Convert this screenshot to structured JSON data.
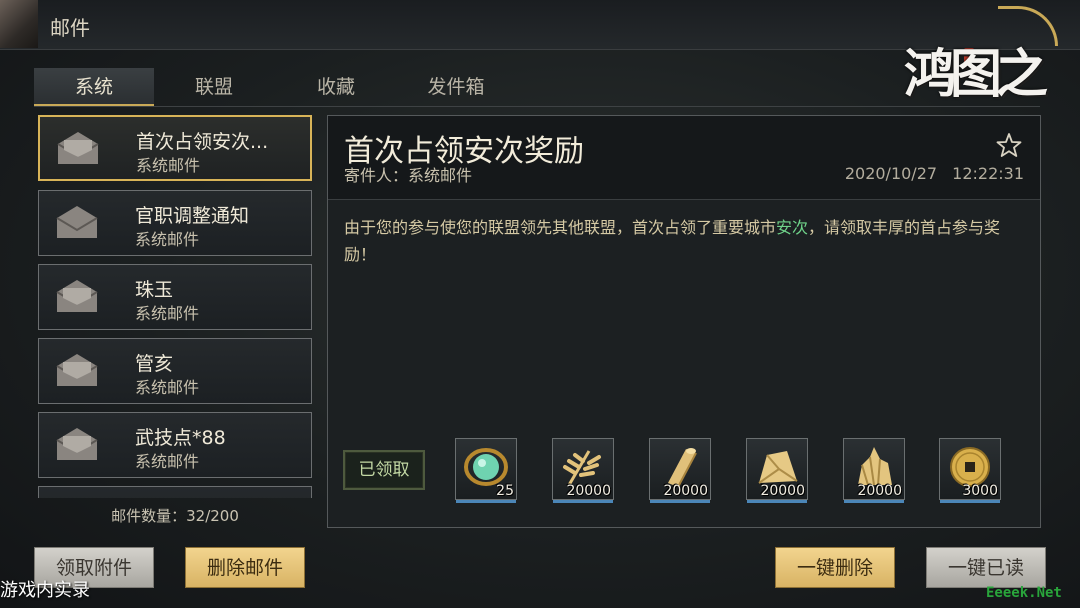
{
  "header": {
    "title": "邮件"
  },
  "logo": {
    "text": "鸿图之下"
  },
  "tabs": [
    {
      "label": "系统",
      "active": true
    },
    {
      "label": "联盟",
      "active": false
    },
    {
      "label": "收藏",
      "active": false
    },
    {
      "label": "发件箱",
      "active": false
    }
  ],
  "mail_list": [
    {
      "subject": "首次占领安次...",
      "sender": "系统邮件",
      "selected": true,
      "icon": "envelope-open-icon"
    },
    {
      "subject": "官职调整通知",
      "sender": "系统邮件",
      "selected": false,
      "icon": "envelope-closed-icon"
    },
    {
      "subject": "珠玉",
      "sender": "系统邮件",
      "selected": false,
      "icon": "envelope-open-icon"
    },
    {
      "subject": "管亥",
      "sender": "系统邮件",
      "selected": false,
      "icon": "envelope-open-icon"
    },
    {
      "subject": "武技点*88",
      "sender": "系统邮件",
      "selected": false,
      "icon": "envelope-open-icon"
    }
  ],
  "mail_count": "邮件数量：32/200",
  "detail": {
    "title": "首次占领安次奖励",
    "sender": "寄件人：系统邮件",
    "date": "2020/10/27",
    "time": "12:22:31",
    "body_prefix": "由于您的参与使您的联盟领先其他联盟，首次占领了重要城市",
    "body_city": "安次",
    "body_suffix": "，请领取丰厚的首占参与奖励！",
    "claimed_label": "已领取",
    "rewards": [
      {
        "icon": "jade-orb-icon",
        "qty": "25"
      },
      {
        "icon": "grain-icon",
        "qty": "20000"
      },
      {
        "icon": "wood-icon",
        "qty": "20000"
      },
      {
        "icon": "stone-icon",
        "qty": "20000"
      },
      {
        "icon": "iron-ore-icon",
        "qty": "20000"
      },
      {
        "icon": "copper-coin-icon",
        "qty": "3000"
      }
    ]
  },
  "buttons": {
    "claim_attachments": "领取附件",
    "delete_mail": "删除邮件",
    "delete_all": "一键删除",
    "read_all": "一键已读"
  },
  "watermarks": {
    "left": "游戏内实录",
    "right": "Eeeek.Net"
  },
  "colors": {
    "accent_gold": "#d8b458",
    "highlight_green": "#6fd38a",
    "reward_bar_blue": "#4b86b8"
  }
}
